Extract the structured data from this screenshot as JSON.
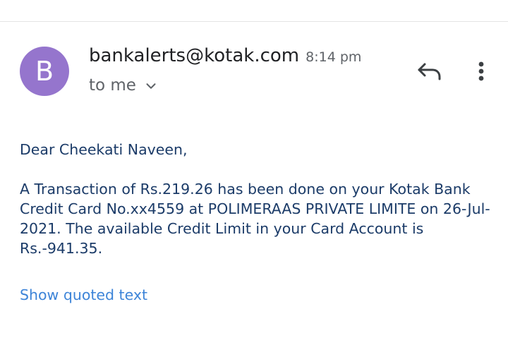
{
  "email": {
    "avatar_letter": "B",
    "avatar_color": "#9575cd",
    "sender": "bankalerts@kotak.com",
    "time": "8:14 pm",
    "recipient_label": "to me",
    "greeting": "Dear Cheekati Naveen,",
    "message": "A Transaction of Rs.219.26 has been done on your Kotak Bank Credit Card No.xx4559 at POLIMERAAS PRIVATE LIMITE on 26-Jul-2021. The available Credit Limit in your Card Account is Rs.-941.35.",
    "show_quoted_label": "Show quoted text"
  },
  "icons": {
    "reply": "reply-icon",
    "more": "more-vert-icon",
    "expand": "chevron-down-icon"
  },
  "colors": {
    "body_text": "#1b3b68",
    "link": "#3d84d8",
    "secondary_text": "#5f6368"
  }
}
